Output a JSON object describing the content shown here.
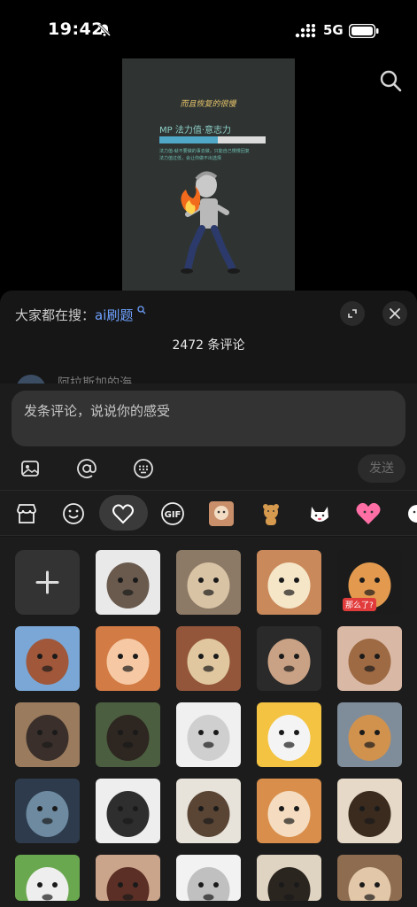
{
  "status_bar": {
    "time": "19:42",
    "network": "5G"
  },
  "video": {
    "caption": "而且恢复的很慢",
    "meter_label": "MP 法力值·意志力",
    "meter_fill": 0.55,
    "note_1": "法力值-就不要做的事去做，只能自己慢慢回复",
    "note_2": "法力值过低，会让你做不出选择"
  },
  "sheet": {
    "hot_prefix": "大家都在搜：",
    "hot_keyword": "ai刷题",
    "count": "2472 条评论",
    "peek_name": "阿拉斯加的海"
  },
  "composer": {
    "placeholder": "发条评论，说说你的感受",
    "send_label": "发送"
  },
  "tabs": [
    "store-icon",
    "smile-icon",
    "heart-icon",
    "gif-icon",
    "cat-sticker",
    "bear-sticker",
    "white-cat-sticker",
    "pink-heart-sticker",
    "sticker-partial"
  ],
  "stickers": {
    "label": "那么了?",
    "items": [
      "baby-wave",
      "panda-bandage",
      "duck-blanket",
      "cat-label",
      "monkey-shirt",
      "cat-grin",
      "cat-scream",
      "man-taped",
      "monkey-clap",
      "dog-nose",
      "bear-cub",
      "blob-face",
      "cat-drink",
      "shiba-smile",
      "man-phone",
      "cow-angry",
      "cow-girl",
      "cat-orange",
      "cat-hat",
      "cow-field",
      "dog-scream",
      "doodle-man",
      "puppy-black",
      "hamster"
    ]
  },
  "colors": {
    "accent": "#6ea1ff",
    "background": "#000000",
    "sheet": "#161616"
  }
}
